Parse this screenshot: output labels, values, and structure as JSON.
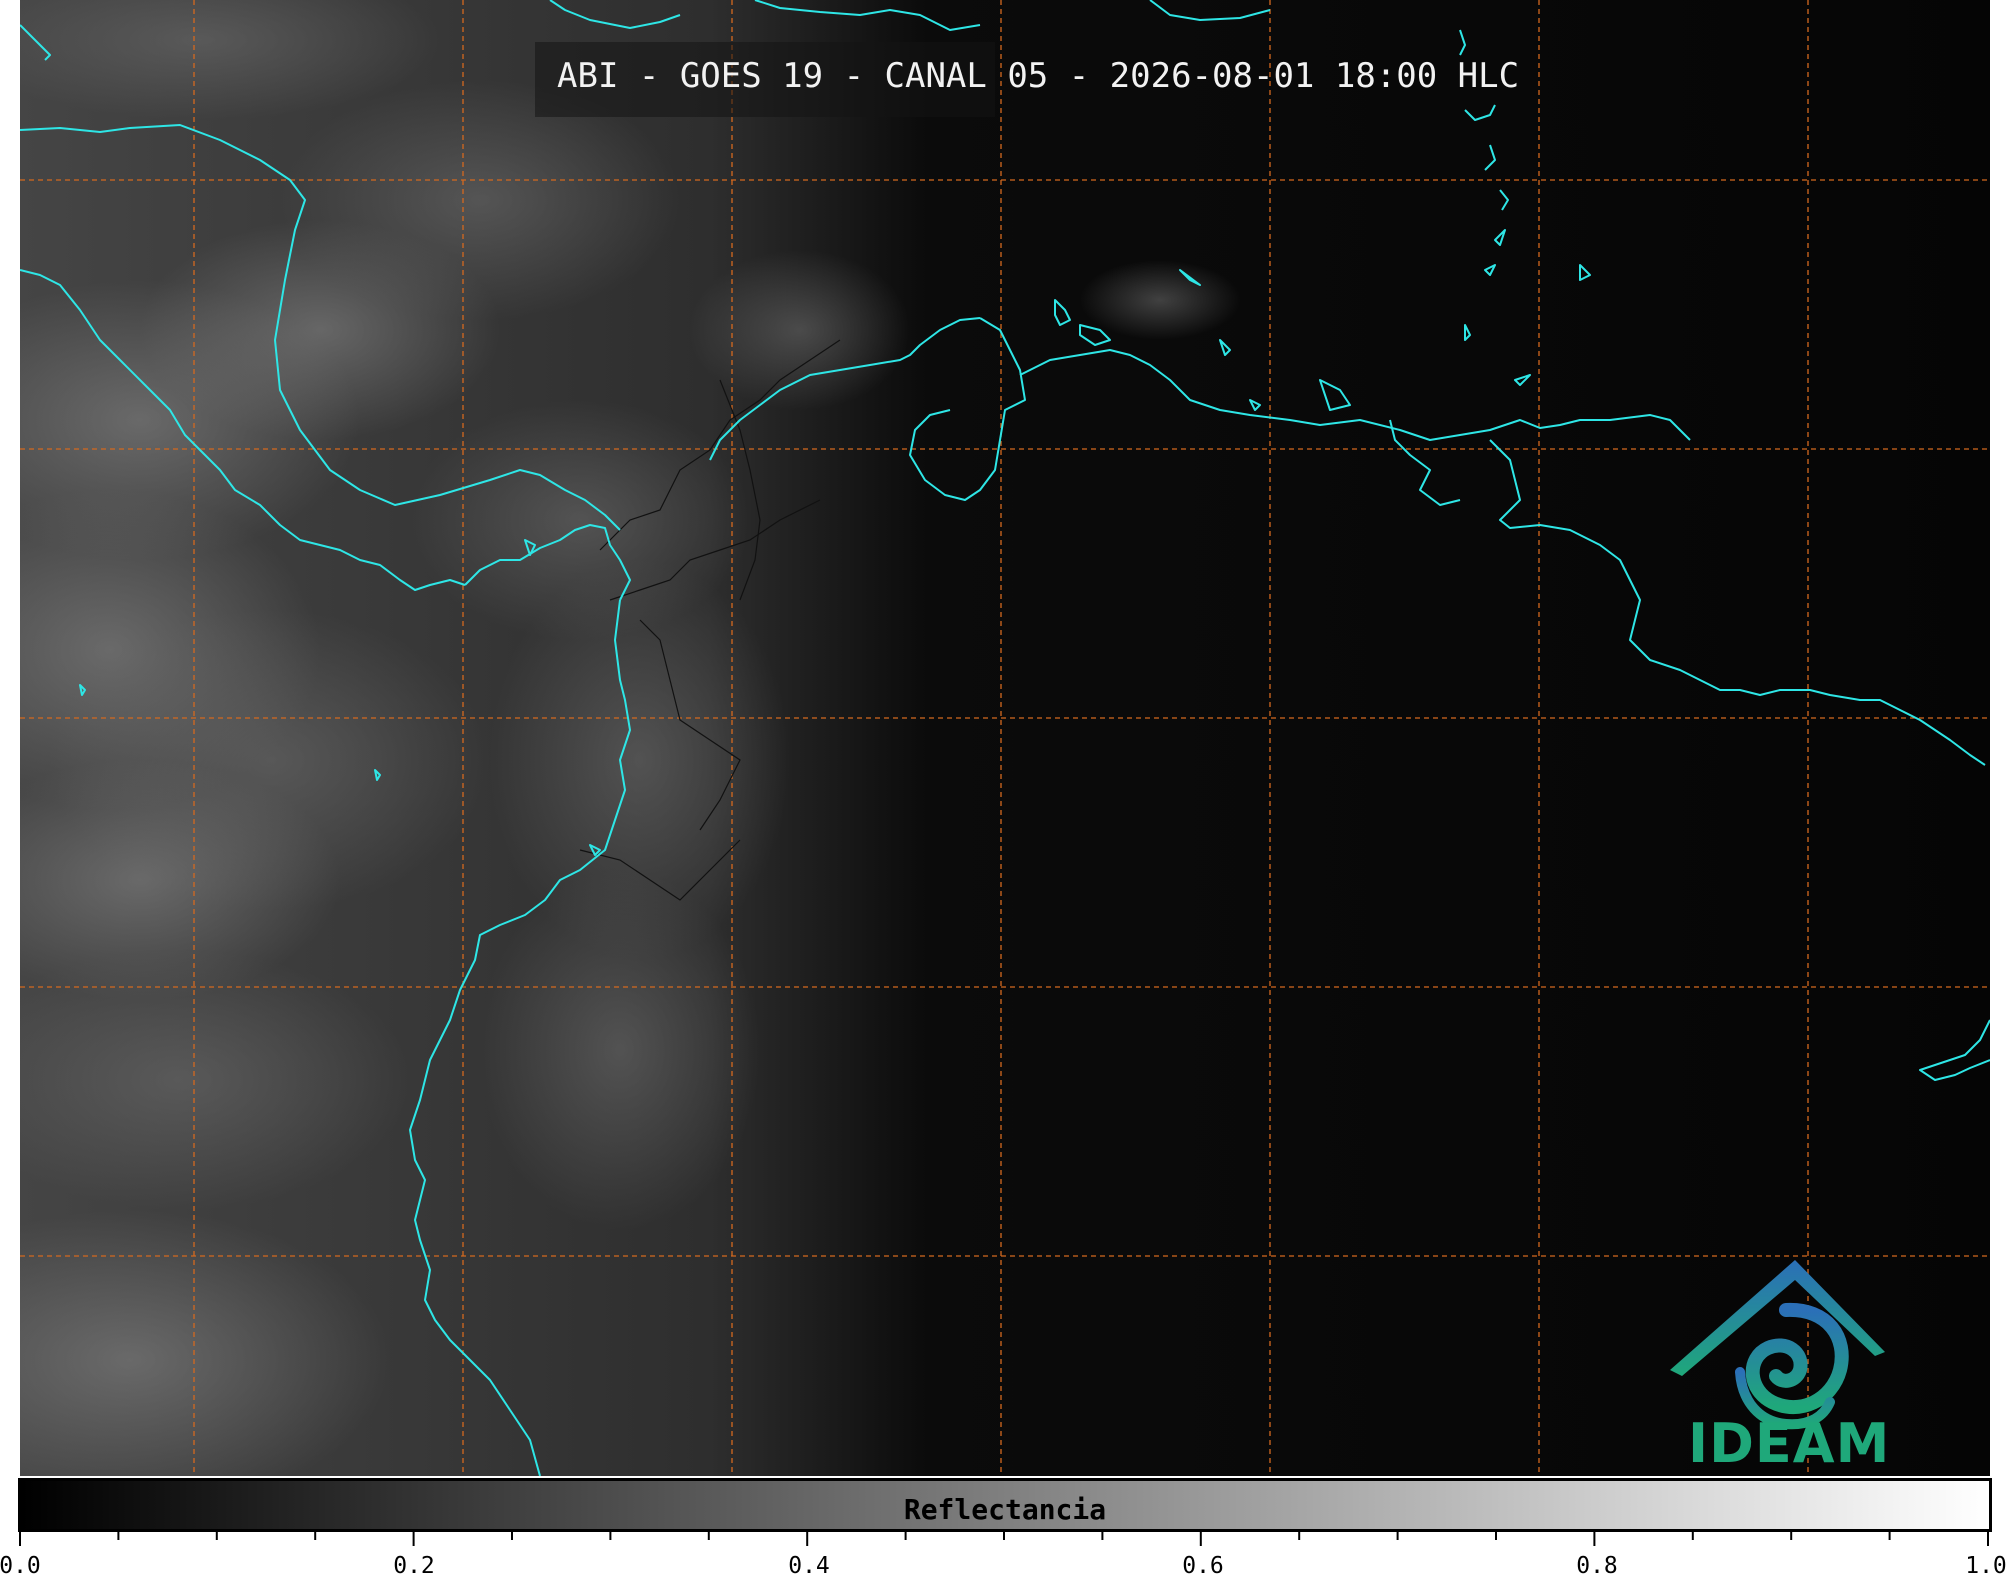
{
  "map": {
    "title": "ABI - GOES 19 - CANAL 05 - 2026-08-01 18:00 HLC",
    "colors": {
      "background": "#050505",
      "coastline": "#2ee6e6",
      "gridlines": "#d4691f",
      "borders": "#111111"
    },
    "icon": "satellite-image"
  },
  "colorbar": {
    "label": "Reflectancia",
    "ticks": [
      "0.0",
      "0.2",
      "0.4",
      "0.6",
      "0.8",
      "1.0"
    ],
    "range": [
      0.0,
      1.0
    ],
    "gradient": [
      "#000000",
      "#ffffff"
    ]
  },
  "logo": {
    "text": "IDEAM",
    "colors": [
      "#2b6fb8",
      "#1fa87a"
    ]
  }
}
